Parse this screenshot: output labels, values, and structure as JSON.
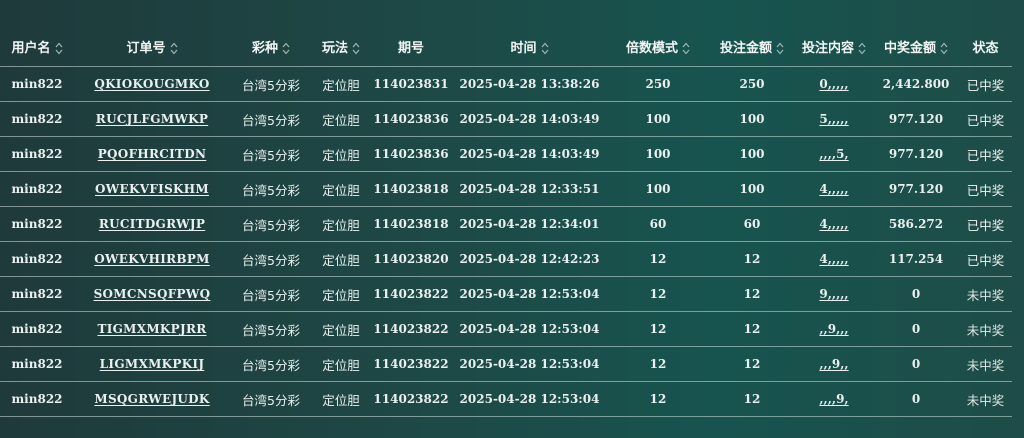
{
  "columns": [
    {
      "key": "user",
      "label": "用户名",
      "sortable": true
    },
    {
      "key": "order",
      "label": "订单号",
      "sortable": true
    },
    {
      "key": "lottery",
      "label": "彩种",
      "sortable": true
    },
    {
      "key": "play",
      "label": "玩法",
      "sortable": true
    },
    {
      "key": "issue",
      "label": "期号",
      "sortable": false
    },
    {
      "key": "time",
      "label": "时间",
      "sortable": true
    },
    {
      "key": "multiple",
      "label": "倍数模式",
      "sortable": true
    },
    {
      "key": "amount",
      "label": "投注金额",
      "sortable": true
    },
    {
      "key": "content",
      "label": "投注内容",
      "sortable": true
    },
    {
      "key": "prize",
      "label": "中奖金额",
      "sortable": true
    },
    {
      "key": "status",
      "label": "状态",
      "sortable": false
    }
  ],
  "rows": [
    {
      "user": "min822",
      "order": "QKIOKOUGMKO",
      "lottery": "台湾5分彩",
      "play": "定位胆",
      "issue": "114023831",
      "time": "2025-04-28 13:38:26",
      "multiple": "250",
      "amount": "250",
      "content": "0,,,,,",
      "prize": "2,442.800",
      "status": "已中奖"
    },
    {
      "user": "min822",
      "order": "RUCJLFGMWKP",
      "lottery": "台湾5分彩",
      "play": "定位胆",
      "issue": "114023836",
      "time": "2025-04-28 14:03:49",
      "multiple": "100",
      "amount": "100",
      "content": "5,,,,,",
      "prize": "977.120",
      "status": "已中奖"
    },
    {
      "user": "min822",
      "order": "PQOFHRCITDN",
      "lottery": "台湾5分彩",
      "play": "定位胆",
      "issue": "114023836",
      "time": "2025-04-28 14:03:49",
      "multiple": "100",
      "amount": "100",
      "content": ",,,,5,",
      "prize": "977.120",
      "status": "已中奖"
    },
    {
      "user": "min822",
      "order": "OWEKVFISKHM",
      "lottery": "台湾5分彩",
      "play": "定位胆",
      "issue": "114023818",
      "time": "2025-04-28 12:33:51",
      "multiple": "100",
      "amount": "100",
      "content": "4,,,,,",
      "prize": "977.120",
      "status": "已中奖"
    },
    {
      "user": "min822",
      "order": "RUCITDGRWJP",
      "lottery": "台湾5分彩",
      "play": "定位胆",
      "issue": "114023818",
      "time": "2025-04-28 12:34:01",
      "multiple": "60",
      "amount": "60",
      "content": "4,,,,,",
      "prize": "586.272",
      "status": "已中奖"
    },
    {
      "user": "min822",
      "order": "OWEKVHIRBPM",
      "lottery": "台湾5分彩",
      "play": "定位胆",
      "issue": "114023820",
      "time": "2025-04-28 12:42:23",
      "multiple": "12",
      "amount": "12",
      "content": "4,,,,,",
      "prize": "117.254",
      "status": "已中奖"
    },
    {
      "user": "min822",
      "order": "SOMCNSQFPWQ",
      "lottery": "台湾5分彩",
      "play": "定位胆",
      "issue": "114023822",
      "time": "2025-04-28 12:53:04",
      "multiple": "12",
      "amount": "12",
      "content": "9,,,,,",
      "prize": "0",
      "status": "未中奖"
    },
    {
      "user": "min822",
      "order": "TIGMXMKPJRR",
      "lottery": "台湾5分彩",
      "play": "定位胆",
      "issue": "114023822",
      "time": "2025-04-28 12:53:04",
      "multiple": "12",
      "amount": "12",
      "content": ",,9,,,",
      "prize": "0",
      "status": "未中奖"
    },
    {
      "user": "min822",
      "order": "LIGMXMKPKIJ",
      "lottery": "台湾5分彩",
      "play": "定位胆",
      "issue": "114023822",
      "time": "2025-04-28 12:53:04",
      "multiple": "12",
      "amount": "12",
      "content": ",,,9,,",
      "prize": "0",
      "status": "未中奖"
    },
    {
      "user": "min822",
      "order": "MSQGRWEJUDK",
      "lottery": "台湾5分彩",
      "play": "定位胆",
      "issue": "114023822",
      "time": "2025-04-28 12:53:04",
      "multiple": "12",
      "amount": "12",
      "content": ",,,,9,",
      "prize": "0",
      "status": "未中奖"
    }
  ],
  "sort_icon": "sort-updown-icon",
  "colors": {
    "background_left": "#1f3a3b",
    "background_right": "#17544f",
    "text": "#e9f0ef",
    "divider": "#cde1de"
  }
}
